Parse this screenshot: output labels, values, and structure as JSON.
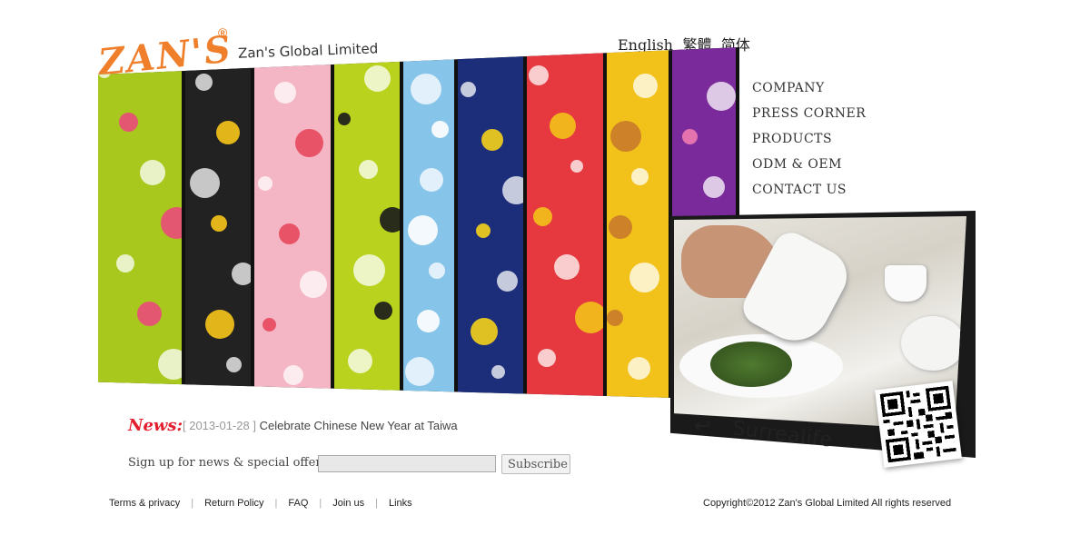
{
  "brand": {
    "logo_text": "ZAN'S",
    "registered": "®",
    "company_name": "Zan's Global Limited"
  },
  "languages": [
    "English",
    "繁體",
    "简体"
  ],
  "nav": [
    "COMPANY",
    "PRESS CORNER",
    "PRODUCTS",
    "ODM & OEM",
    "CONTACT US"
  ],
  "tagline": "Surrealife",
  "news": {
    "label": "News:",
    "date": "[ 2013-01-28 ]",
    "title": "Celebrate Chinese New Year at Taiwa"
  },
  "signup": {
    "label": "Sign up for news & special offers:",
    "input_value": "",
    "button": "Subscribe"
  },
  "footer": {
    "links": [
      "Terms & privacy",
      "Return Policy",
      "FAQ",
      "Join us",
      "Links"
    ],
    "copyright": "Copyright©2012 Zan's Global Limited All rights reserved"
  },
  "colors": {
    "brand_orange": "#ef7f2a",
    "news_red": "#e31e2d"
  },
  "banner_strips": [
    {
      "name": "green-tea",
      "bg": "#a8c81e",
      "accent": "#e94a7a"
    },
    {
      "name": "colorful-cows",
      "bg": "#222222",
      "accent": "#f7c51a"
    },
    {
      "name": "pink-cow",
      "bg": "#f4b5c4",
      "accent": "#e8485e"
    },
    {
      "name": "lime-cow",
      "bg": "#b8d21e",
      "accent": "#1a1a1a"
    },
    {
      "name": "blue-cat",
      "bg": "#86c4ea",
      "accent": "#ffffff"
    },
    {
      "name": "navy-bells",
      "bg": "#1c2d7a",
      "accent": "#f5d21a"
    },
    {
      "name": "red-guitar",
      "bg": "#e5383f",
      "accent": "#f3c21a"
    },
    {
      "name": "cheese-mouse",
      "bg": "#f2c21a",
      "accent": "#c97a2a"
    },
    {
      "name": "purple-cake",
      "bg": "#7a2a9a",
      "accent": "#f07ab0"
    }
  ]
}
